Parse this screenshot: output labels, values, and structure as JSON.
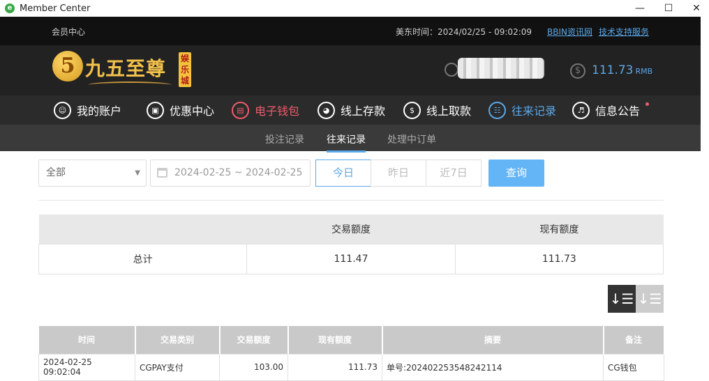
{
  "window": {
    "title": "Member Center",
    "icon_letter": "e",
    "minimize": "—",
    "maximize": "☐",
    "close": "✕"
  },
  "topbar": {
    "member_label": "会员中心",
    "time_text": "美东时间：2024/02/25 - 09:02:09",
    "link_news": "BBIN资讯网",
    "link_support": "技术支持服务"
  },
  "header": {
    "logo_mark": "5",
    "logo_text": "九五至尊",
    "logo_badge": "娱乐城",
    "balance": "111.73",
    "currency": "RMB"
  },
  "nav": {
    "items": [
      {
        "label": "我的账户",
        "icon": "user-circle-icon"
      },
      {
        "label": "优惠中心",
        "icon": "gift-icon"
      },
      {
        "label": "电子钱包",
        "icon": "wallet-icon"
      },
      {
        "label": "线上存款",
        "icon": "deposit-icon"
      },
      {
        "label": "线上取款",
        "icon": "withdraw-icon"
      },
      {
        "label": "往来记录",
        "icon": "records-icon"
      },
      {
        "label": "信息公告",
        "icon": "bell-icon"
      }
    ]
  },
  "subnav": {
    "tabs": [
      "投注记录",
      "往来记录",
      "处理中订单"
    ],
    "active": "往来记录"
  },
  "filters": {
    "type_select": "全部",
    "date_range": "2024-02-25 ~ 2024-02-25",
    "ranges": [
      "今日",
      "昨日",
      "近7日"
    ],
    "query_label": "查询"
  },
  "summary": {
    "headers": [
      "",
      "交易额度",
      "现有额度"
    ],
    "row": [
      "总计",
      "111.47",
      "111.73"
    ]
  },
  "records": {
    "headers": [
      "时间",
      "交易类别",
      "交易额度",
      "现有额度",
      "摘要",
      "备注"
    ],
    "rows": [
      [
        "2024-02-25 09:02:04",
        "CGPAY支付",
        "103.00",
        "111.73",
        "单号:202402253548242114",
        "CG钱包"
      ]
    ]
  },
  "colors": {
    "accent_blue": "#5aa8e8",
    "accent_red": "#ef5b6b",
    "gold": "#f4c24a"
  }
}
